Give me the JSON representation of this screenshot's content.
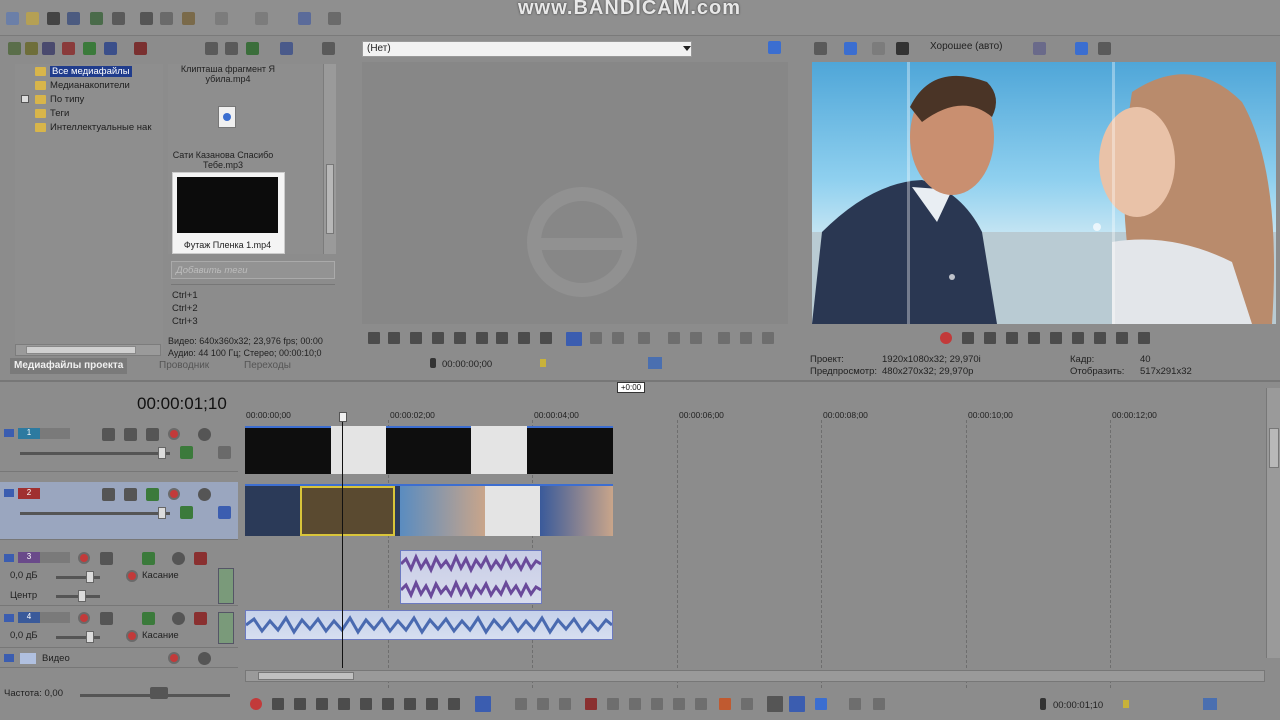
{
  "watermark": "www.BANDICAM.com",
  "explorer": {
    "tree": [
      {
        "label": "Все медиафайлы",
        "selected": true
      },
      {
        "label": "Медианакопители"
      },
      {
        "label": "По типу"
      },
      {
        "label": "Теги"
      },
      {
        "label": "Интеллектуальные нак"
      }
    ],
    "media_items": [
      {
        "label": "Клипташа фрагмент Я убила.mp4"
      },
      {
        "label": "Сати Казанова Спасибо Тебе.mp3"
      },
      {
        "label": "Футаж Пленка 1.mp4"
      }
    ],
    "tag_placeholder": "Добавить теги",
    "shortcuts": [
      "Ctrl+1",
      "Ctrl+2",
      "Ctrl+3"
    ],
    "info_video": "Видео: 640x360x32; 23,976 fps; 00:00",
    "info_audio": "Аудио: 44 100 Гц; Стерео; 00:00:10;0",
    "tabs": [
      "Медиафайлы проекта",
      "Проводник",
      "Переходы"
    ]
  },
  "trimmer": {
    "select_value": "(Нет)",
    "timecode": "00:00:00;00"
  },
  "preview": {
    "quality": "Хорошее (авто)",
    "project_label": "Проект:",
    "project_value": "1920x1080x32; 29,970i",
    "preview_label": "Предпросмотр:",
    "preview_value": "480x270x32; 29,970p",
    "frame_label": "Кадр:",
    "frame_value": "40",
    "display_label": "Отобразить:",
    "display_value": "517x291x32"
  },
  "timeline": {
    "main_timecode": "00:00:01;10",
    "ruler_badge": "+0:00",
    "ruler": [
      "00:00:00;00",
      "00:00:02;00",
      "00:00:04;00",
      "00:00:06;00",
      "00:00:08;00",
      "00:00:10;00",
      "00:00:12;00"
    ],
    "tracks": [
      {
        "num": "1"
      },
      {
        "num": "2"
      },
      {
        "num": "3",
        "volume": "0,0 дБ",
        "mode": "Касание",
        "pan": "Центр"
      },
      {
        "num": "4",
        "volume": "0,0 дБ",
        "mode": "Касание"
      }
    ],
    "bus_label": "Видео",
    "rate_label": "Частота: 0,00",
    "bottom_timecode": "00:00:01;10"
  },
  "colors": {
    "accent_blue": "#3d6ed0",
    "record_red": "#c23a3a",
    "selected_track": "#9aa6bf"
  }
}
